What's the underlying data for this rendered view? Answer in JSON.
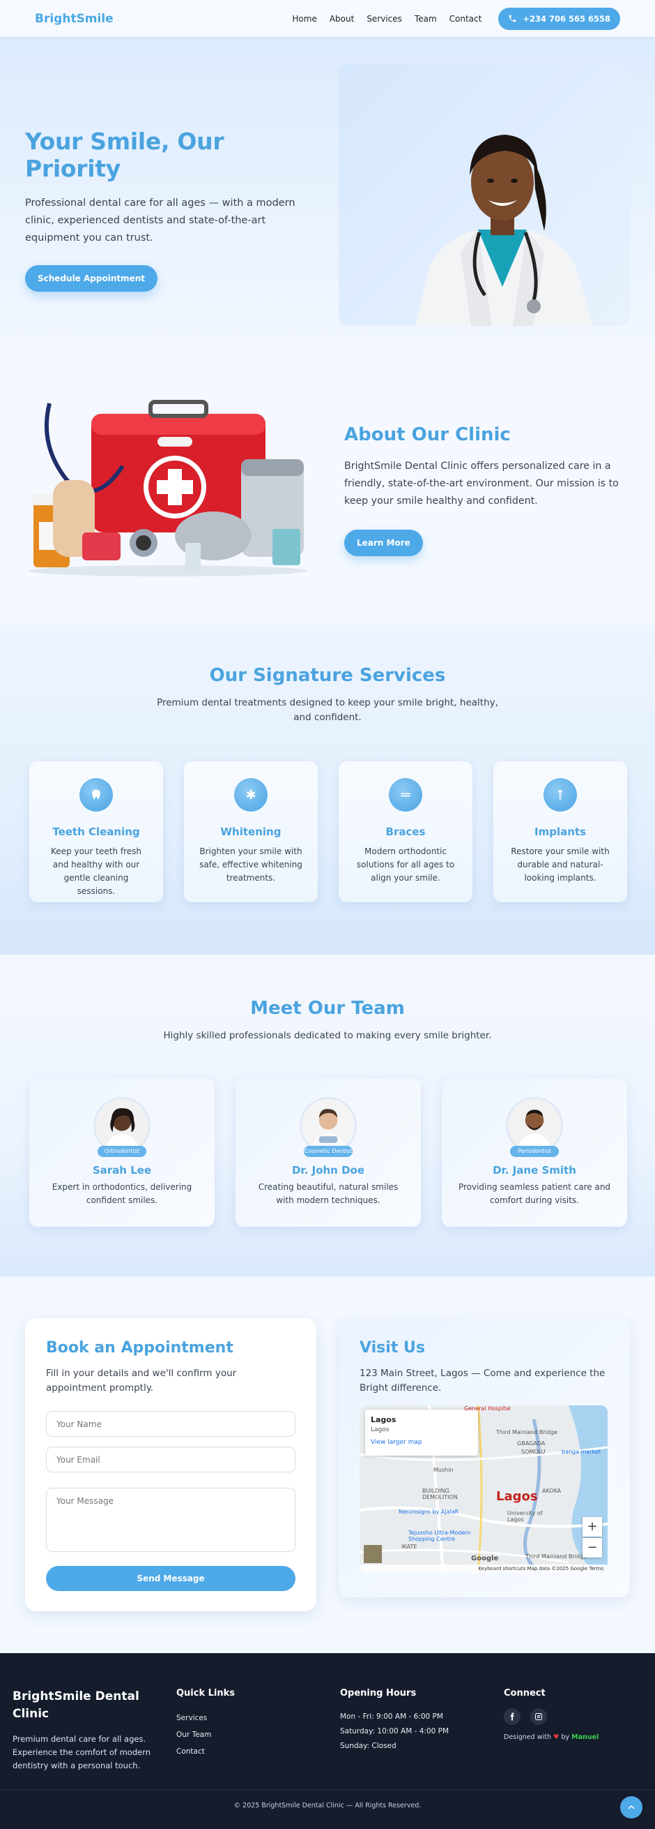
{
  "nav": {
    "brand": "BrightSmile",
    "links": [
      "Home",
      "About",
      "Services",
      "Team",
      "Contact"
    ],
    "phone": "+234 706 565 6558"
  },
  "hero": {
    "title": "Your Smile, Our Priority",
    "description": "Professional dental care for all ages — with a modern clinic, experienced dentists and state-of-the-art equipment you can trust.",
    "cta": "Schedule Appointment"
  },
  "about": {
    "title": "About Our Clinic",
    "description": "BrightSmile Dental Clinic offers personalized care in a friendly, state-of-the-art environment. Our mission is to keep your smile healthy and confident.",
    "cta": "Learn More"
  },
  "services": {
    "title": "Our Signature Services",
    "subtitle": "Premium dental treatments designed to keep your smile bright, healthy, and confident.",
    "items": [
      {
        "name": "Teeth Cleaning",
        "description": "Keep your teeth fresh and healthy with our gentle cleaning sessions.",
        "icon": "tooth-icon"
      },
      {
        "name": "Whitening",
        "description": "Brighten your smile with safe, effective whitening treatments.",
        "icon": "sparkle-icon"
      },
      {
        "name": "Braces",
        "description": "Modern orthodontic solutions for all ages to align your smile.",
        "icon": "braces-icon"
      },
      {
        "name": "Implants",
        "description": "Restore your smile with durable and natural-looking implants.",
        "icon": "implant-icon"
      }
    ]
  },
  "team": {
    "title": "Meet Our Team",
    "subtitle": "Highly skilled professionals dedicated to making every smile brighter.",
    "members": [
      {
        "name": "Sarah Lee",
        "role": "Orthodontist",
        "description": "Expert in orthodontics, delivering confident smiles."
      },
      {
        "name": "Dr. John Doe",
        "role": "Cosmetic Dentist",
        "description": "Creating beautiful, natural smiles with modern techniques."
      },
      {
        "name": "Dr. Jane Smith",
        "role": "Periodontist",
        "description": "Providing seamless patient care and comfort during visits."
      }
    ]
  },
  "booking": {
    "title": "Book an Appointment",
    "description": "Fill in your details and we'll confirm your appointment promptly.",
    "name_placeholder": "Your Name",
    "email_placeholder": "Your Email",
    "message_placeholder": "Your Message",
    "submit": "Send Message"
  },
  "visit": {
    "title": "Visit Us",
    "description": "123 Main Street, Lagos — Come and experience the Bright difference.",
    "map": {
      "popup_title": "Lagos",
      "popup_sub": "Lagos",
      "popup_link": "View larger map",
      "city_label": "Lagos",
      "labels": [
        "Third Mainland Bridge",
        "Mushin",
        "BUILDING DEMOLITION",
        "Neconsigns by AjalaR",
        "Tejuosho Ultra-Modern Shopping Centre",
        "AKOKA",
        "University of Lagos",
        "IKATE",
        "Third Mainland Bridge",
        "General Hospital",
        "banga market",
        "GBAGADA",
        "SOMOLU",
        "Google"
      ],
      "footer": "Keyboard shortcuts   Map data ©2025 Google   Terms"
    }
  },
  "footer": {
    "brand": "BrightSmile Dental Clinic",
    "about": "Premium dental care for all ages. Experience the comfort of modern dentistry with a personal touch.",
    "quick_links_title": "Quick Links",
    "quick_links": [
      "Services",
      "Our Team",
      "Contact"
    ],
    "hours_title": "Opening Hours",
    "hours": [
      "Mon - Fri: 9:00 AM - 6:00 PM",
      "Saturday: 10:00 AM - 4:00 PM",
      "Sunday: Closed"
    ],
    "connect_title": "Connect",
    "designed_prefix": "Designed with",
    "designed_by": "by",
    "author": "Manuel",
    "copyright": "© 2025 BrightSmile Dental Clinic — All Rights Reserved."
  },
  "colors": {
    "accent": "#4ea9e8",
    "heading": "#4aa3df",
    "footer_bg": "#151c2c",
    "author": "#3ccf4e"
  }
}
